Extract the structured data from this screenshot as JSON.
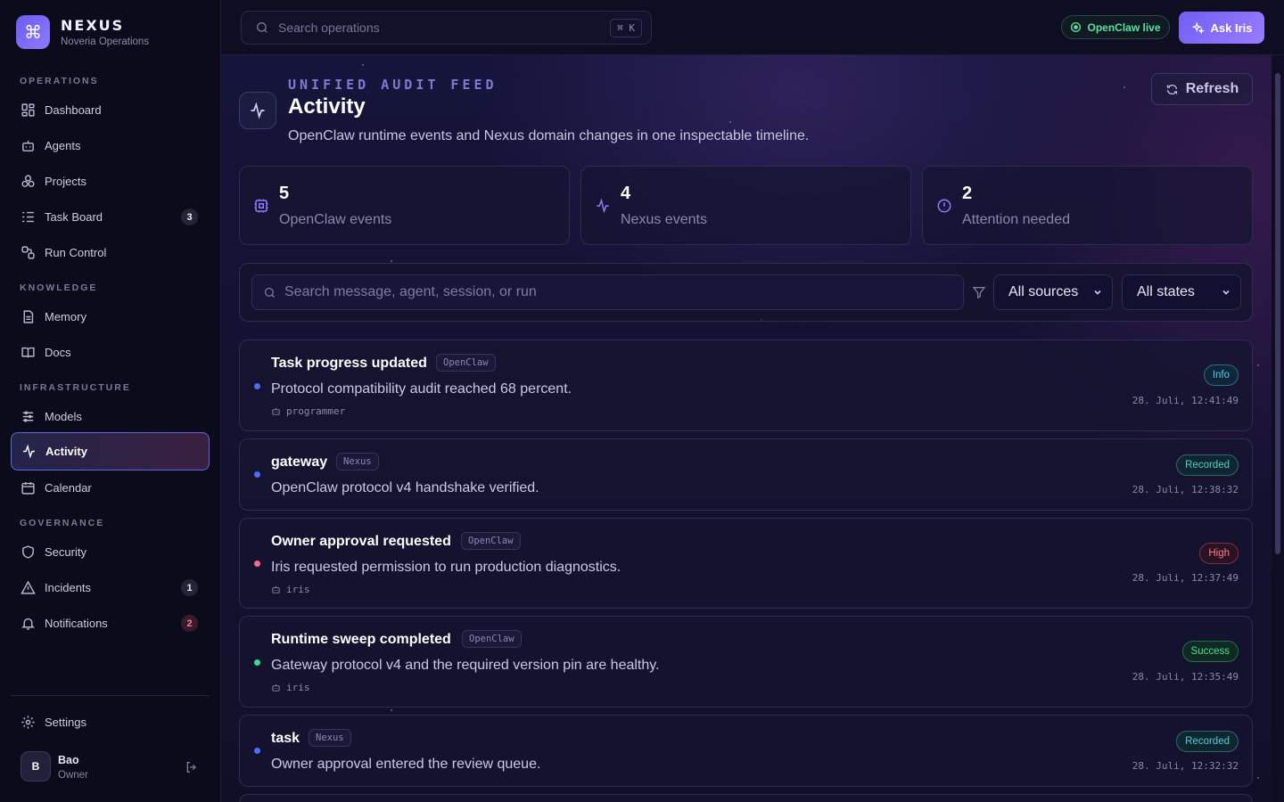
{
  "brand": {
    "name": "NEXUS",
    "org": "Noveria Operations"
  },
  "sidebar": {
    "sections": [
      "OPERATIONS",
      "KNOWLEDGE",
      "INFRASTRUCTURE",
      "GOVERNANCE"
    ],
    "items": [
      {
        "label": "Dashboard",
        "icon": "dashboard-icon"
      },
      {
        "label": "Agents",
        "icon": "bot-icon"
      },
      {
        "label": "Projects",
        "icon": "projects-icon"
      },
      {
        "label": "Task Board",
        "icon": "task-board-icon",
        "badge": "3"
      },
      {
        "label": "Run Control",
        "icon": "run-control-icon"
      },
      {
        "label": "Memory",
        "icon": "memory-icon"
      },
      {
        "label": "Docs",
        "icon": "book-icon"
      },
      {
        "label": "Models",
        "icon": "sliders-icon"
      },
      {
        "label": "Activity",
        "icon": "activity-icon",
        "active": true
      },
      {
        "label": "Calendar",
        "icon": "calendar-icon"
      },
      {
        "label": "Security",
        "icon": "shield-icon"
      },
      {
        "label": "Incidents",
        "icon": "warning-icon",
        "badge": "1"
      },
      {
        "label": "Notifications",
        "icon": "bell-icon",
        "badge": "2"
      }
    ],
    "settings_label": "Settings",
    "user": {
      "initial": "B",
      "name": "Bao",
      "role": "Owner"
    }
  },
  "topbar": {
    "search_placeholder": "Search operations",
    "shortcut": "⌘ K",
    "live_label": "OpenClaw live",
    "ask_label": "Ask Iris"
  },
  "page": {
    "eyebrow": "UNIFIED AUDIT FEED",
    "title": "Activity",
    "subtitle": "OpenClaw runtime events and Nexus domain changes in one inspectable timeline.",
    "refresh_label": "Refresh"
  },
  "stats": [
    {
      "value": "5",
      "label": "OpenClaw events"
    },
    {
      "value": "4",
      "label": "Nexus events"
    },
    {
      "value": "2",
      "label": "Attention needed"
    }
  ],
  "filters": {
    "search_placeholder": "Search message, agent, session, or run",
    "source_selected": "All sources",
    "state_selected": "All states"
  },
  "events": [
    {
      "title": "Task progress updated",
      "source": "OpenClaw",
      "message": "Protocol compatibility audit reached 68 percent.",
      "actor": "programmer",
      "state": "Info",
      "time": "28. Juli, 12:41:49"
    },
    {
      "title": "gateway",
      "source": "Nexus",
      "message": "OpenClaw protocol v4 handshake verified.",
      "actor": "",
      "state": "Recorded",
      "time": "28. Juli, 12:38:32"
    },
    {
      "title": "Owner approval requested",
      "source": "OpenClaw",
      "message": "Iris requested permission to run production diagnostics.",
      "actor": "iris",
      "state": "High",
      "time": "28. Juli, 12:37:49"
    },
    {
      "title": "Runtime sweep completed",
      "source": "OpenClaw",
      "message": "Gateway protocol v4 and the required version pin are healthy.",
      "actor": "iris",
      "state": "Success",
      "time": "28. Juli, 12:35:49"
    },
    {
      "title": "task",
      "source": "Nexus",
      "message": "Owner approval entered the review queue.",
      "actor": "",
      "state": "Recorded",
      "time": "28. Juli, 12:32:32"
    }
  ],
  "colors": {
    "accent": "#6f5ff2",
    "info": "#5dc6f0",
    "recorded": "#4fd2c6",
    "high": "#ff7a90",
    "success": "#4fe09a"
  }
}
